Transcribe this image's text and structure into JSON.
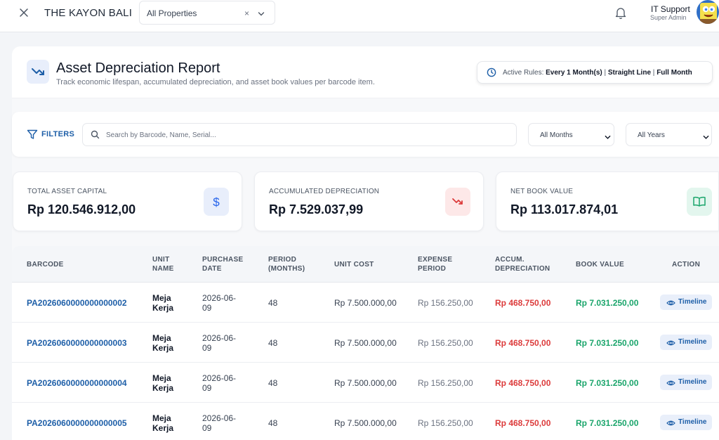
{
  "topbar": {
    "property_name": "THE KAYON BALI",
    "property_filter": "All Properties",
    "clear_symbol": "×",
    "user_name": "IT Support",
    "user_role": "Super Admin"
  },
  "header": {
    "title": "Asset Depreciation Report",
    "subtitle": "Track economic lifespan, accumulated depreciation, and asset book values per barcode item.",
    "rules_label": "Active Rules:",
    "rule_interval": "Every 1 Month(s)",
    "rule_method": "Straight Line",
    "rule_period": "Full Month",
    "separator": "|"
  },
  "filters": {
    "label": "FILTERS",
    "search_placeholder": "Search by Barcode, Name, Serial...",
    "month_value": "All Months",
    "year_value": "All Years"
  },
  "stats": [
    {
      "label": "TOTAL ASSET CAPITAL",
      "value": "Rp 120.546.912,00",
      "icon": "dollar-icon",
      "color": "#2563eb"
    },
    {
      "label": "ACCUMULATED DEPRECIATION",
      "value": "Rp 7.529.037,99",
      "icon": "trending-down-icon",
      "color": "#dc3b3b"
    },
    {
      "label": "NET BOOK VALUE",
      "value": "Rp 113.017.874,01",
      "icon": "book-open-icon",
      "color": "#1aa56b"
    }
  ],
  "table": {
    "headers": {
      "barcode": "BARCODE",
      "unit_name_1": "UNIT",
      "unit_name_2": "NAME",
      "purchase_1": "PURCHASE",
      "purchase_2": "DATE",
      "period_1": "PERIOD",
      "period_2": "(MONTHS)",
      "unit_cost": "UNIT COST",
      "expense_1": "EXPENSE",
      "expense_2": "PERIOD",
      "accum_1": "ACCUM.",
      "accum_2": "DEPRECIATION",
      "book_value": "BOOK VALUE",
      "action": "ACTION"
    },
    "rows": [
      {
        "barcode": "PA2026060000000000002",
        "unit_1": "Meja",
        "unit_2": "Kerja",
        "date_1": "2026-06-",
        "date_2": "09",
        "period": "48",
        "unit_cost": "Rp 7.500.000,00",
        "expense": "Rp 156.250,00",
        "accum": "Rp 468.750,00",
        "book": "Rp 7.031.250,00",
        "action": "Timeline"
      },
      {
        "barcode": "PA2026060000000000003",
        "unit_1": "Meja",
        "unit_2": "Kerja",
        "date_1": "2026-06-",
        "date_2": "09",
        "period": "48",
        "unit_cost": "Rp 7.500.000,00",
        "expense": "Rp 156.250,00",
        "accum": "Rp 468.750,00",
        "book": "Rp 7.031.250,00",
        "action": "Timeline"
      },
      {
        "barcode": "PA2026060000000000004",
        "unit_1": "Meja",
        "unit_2": "Kerja",
        "date_1": "2026-06-",
        "date_2": "09",
        "period": "48",
        "unit_cost": "Rp 7.500.000,00",
        "expense": "Rp 156.250,00",
        "accum": "Rp 468.750,00",
        "book": "Rp 7.031.250,00",
        "action": "Timeline"
      },
      {
        "barcode": "PA2026060000000000005",
        "unit_1": "Meja",
        "unit_2": "Kerja",
        "date_1": "2026-06-",
        "date_2": "09",
        "period": "48",
        "unit_cost": "Rp 7.500.000,00",
        "expense": "Rp 156.250,00",
        "accum": "Rp 468.750,00",
        "book": "Rp 7.031.250,00",
        "action": "Timeline"
      }
    ]
  }
}
